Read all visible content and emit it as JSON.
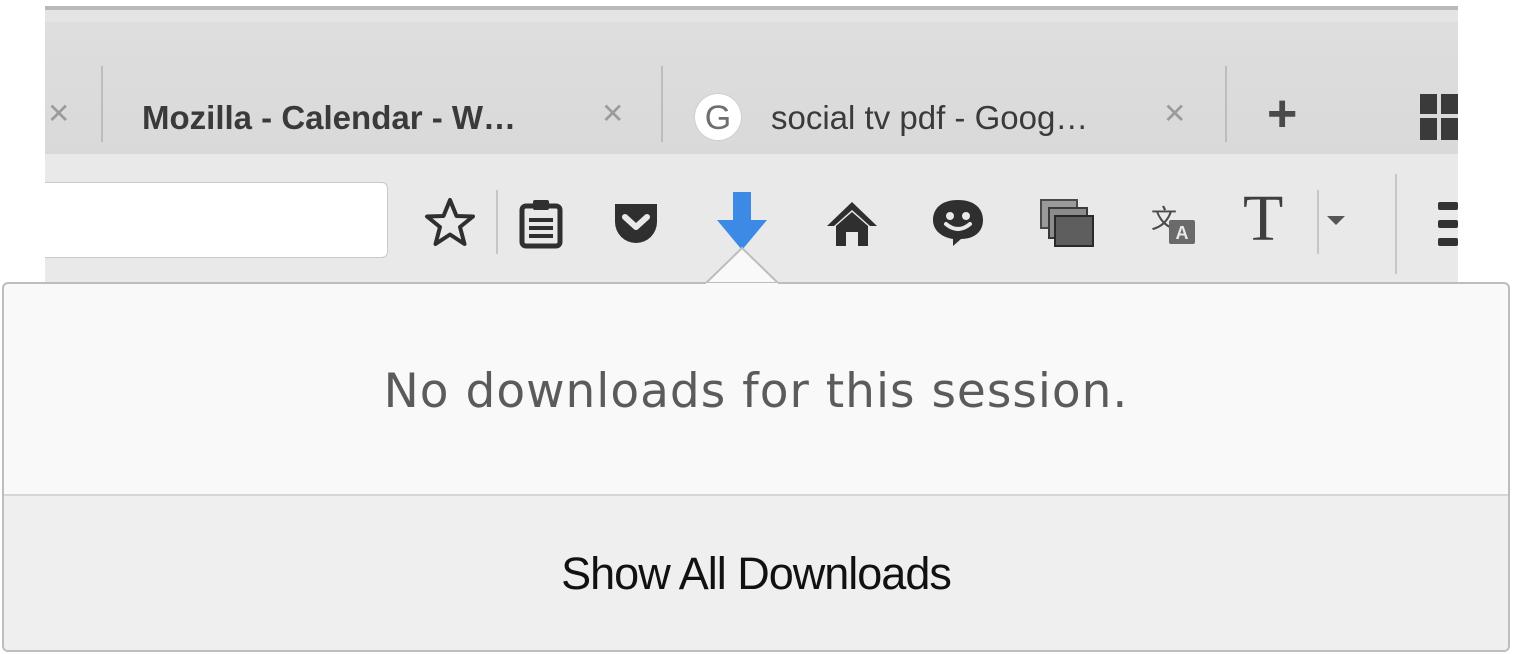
{
  "tabs": [
    {
      "title": "Mozilla - Calendar - W…"
    },
    {
      "title": "social tv pdf - Goog…",
      "favicon": "google-g-icon"
    }
  ],
  "new_tab_label": "+",
  "toolbar": {
    "icons": [
      "star-bookmark-icon",
      "reading-list-icon",
      "pocket-icon",
      "download-arrow-icon",
      "home-icon",
      "smiley-icon",
      "screenshot-icon",
      "translate-icon",
      "font-t-icon",
      "menu-icon"
    ],
    "font_t_glyph": "T",
    "download_accent": "#3d8ae6"
  },
  "downloads_panel": {
    "empty_message": "No downloads for this session.",
    "show_all_label": "Show All Downloads"
  }
}
